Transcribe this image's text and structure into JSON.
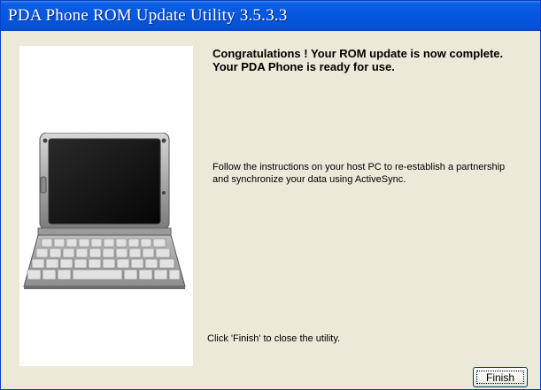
{
  "window": {
    "title": "PDA Phone ROM Update Utility 3.5.3.3"
  },
  "content": {
    "completion_message": "Congratulations ! Your ROM update is now complete. Your PDA Phone is ready for use.",
    "instructions": "Follow the instructions on your host PC to re-establish a partnership and synchronize your data using ActiveSync.",
    "close_hint": "Click 'Finish' to close the utility."
  },
  "buttons": {
    "finish_label": "Finish"
  },
  "colors": {
    "titlebar": "#0756e0",
    "dialog_background": "#ece9d8",
    "image_panel": "#ffffff"
  }
}
